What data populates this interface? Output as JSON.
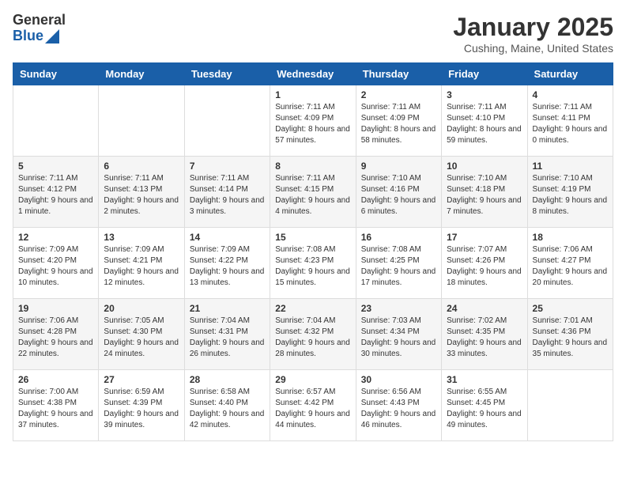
{
  "header": {
    "logo_general": "General",
    "logo_blue": "Blue",
    "month_year": "January 2025",
    "location": "Cushing, Maine, United States"
  },
  "days_of_week": [
    "Sunday",
    "Monday",
    "Tuesday",
    "Wednesday",
    "Thursday",
    "Friday",
    "Saturday"
  ],
  "weeks": [
    [
      {
        "day": "",
        "info": ""
      },
      {
        "day": "",
        "info": ""
      },
      {
        "day": "",
        "info": ""
      },
      {
        "day": "1",
        "info": "Sunrise: 7:11 AM\nSunset: 4:09 PM\nDaylight: 8 hours and 57 minutes."
      },
      {
        "day": "2",
        "info": "Sunrise: 7:11 AM\nSunset: 4:09 PM\nDaylight: 8 hours and 58 minutes."
      },
      {
        "day": "3",
        "info": "Sunrise: 7:11 AM\nSunset: 4:10 PM\nDaylight: 8 hours and 59 minutes."
      },
      {
        "day": "4",
        "info": "Sunrise: 7:11 AM\nSunset: 4:11 PM\nDaylight: 9 hours and 0 minutes."
      }
    ],
    [
      {
        "day": "5",
        "info": "Sunrise: 7:11 AM\nSunset: 4:12 PM\nDaylight: 9 hours and 1 minute."
      },
      {
        "day": "6",
        "info": "Sunrise: 7:11 AM\nSunset: 4:13 PM\nDaylight: 9 hours and 2 minutes."
      },
      {
        "day": "7",
        "info": "Sunrise: 7:11 AM\nSunset: 4:14 PM\nDaylight: 9 hours and 3 minutes."
      },
      {
        "day": "8",
        "info": "Sunrise: 7:11 AM\nSunset: 4:15 PM\nDaylight: 9 hours and 4 minutes."
      },
      {
        "day": "9",
        "info": "Sunrise: 7:10 AM\nSunset: 4:16 PM\nDaylight: 9 hours and 6 minutes."
      },
      {
        "day": "10",
        "info": "Sunrise: 7:10 AM\nSunset: 4:18 PM\nDaylight: 9 hours and 7 minutes."
      },
      {
        "day": "11",
        "info": "Sunrise: 7:10 AM\nSunset: 4:19 PM\nDaylight: 9 hours and 8 minutes."
      }
    ],
    [
      {
        "day": "12",
        "info": "Sunrise: 7:09 AM\nSunset: 4:20 PM\nDaylight: 9 hours and 10 minutes."
      },
      {
        "day": "13",
        "info": "Sunrise: 7:09 AM\nSunset: 4:21 PM\nDaylight: 9 hours and 12 minutes."
      },
      {
        "day": "14",
        "info": "Sunrise: 7:09 AM\nSunset: 4:22 PM\nDaylight: 9 hours and 13 minutes."
      },
      {
        "day": "15",
        "info": "Sunrise: 7:08 AM\nSunset: 4:23 PM\nDaylight: 9 hours and 15 minutes."
      },
      {
        "day": "16",
        "info": "Sunrise: 7:08 AM\nSunset: 4:25 PM\nDaylight: 9 hours and 17 minutes."
      },
      {
        "day": "17",
        "info": "Sunrise: 7:07 AM\nSunset: 4:26 PM\nDaylight: 9 hours and 18 minutes."
      },
      {
        "day": "18",
        "info": "Sunrise: 7:06 AM\nSunset: 4:27 PM\nDaylight: 9 hours and 20 minutes."
      }
    ],
    [
      {
        "day": "19",
        "info": "Sunrise: 7:06 AM\nSunset: 4:28 PM\nDaylight: 9 hours and 22 minutes."
      },
      {
        "day": "20",
        "info": "Sunrise: 7:05 AM\nSunset: 4:30 PM\nDaylight: 9 hours and 24 minutes."
      },
      {
        "day": "21",
        "info": "Sunrise: 7:04 AM\nSunset: 4:31 PM\nDaylight: 9 hours and 26 minutes."
      },
      {
        "day": "22",
        "info": "Sunrise: 7:04 AM\nSunset: 4:32 PM\nDaylight: 9 hours and 28 minutes."
      },
      {
        "day": "23",
        "info": "Sunrise: 7:03 AM\nSunset: 4:34 PM\nDaylight: 9 hours and 30 minutes."
      },
      {
        "day": "24",
        "info": "Sunrise: 7:02 AM\nSunset: 4:35 PM\nDaylight: 9 hours and 33 minutes."
      },
      {
        "day": "25",
        "info": "Sunrise: 7:01 AM\nSunset: 4:36 PM\nDaylight: 9 hours and 35 minutes."
      }
    ],
    [
      {
        "day": "26",
        "info": "Sunrise: 7:00 AM\nSunset: 4:38 PM\nDaylight: 9 hours and 37 minutes."
      },
      {
        "day": "27",
        "info": "Sunrise: 6:59 AM\nSunset: 4:39 PM\nDaylight: 9 hours and 39 minutes."
      },
      {
        "day": "28",
        "info": "Sunrise: 6:58 AM\nSunset: 4:40 PM\nDaylight: 9 hours and 42 minutes."
      },
      {
        "day": "29",
        "info": "Sunrise: 6:57 AM\nSunset: 4:42 PM\nDaylight: 9 hours and 44 minutes."
      },
      {
        "day": "30",
        "info": "Sunrise: 6:56 AM\nSunset: 4:43 PM\nDaylight: 9 hours and 46 minutes."
      },
      {
        "day": "31",
        "info": "Sunrise: 6:55 AM\nSunset: 4:45 PM\nDaylight: 9 hours and 49 minutes."
      },
      {
        "day": "",
        "info": ""
      }
    ]
  ]
}
